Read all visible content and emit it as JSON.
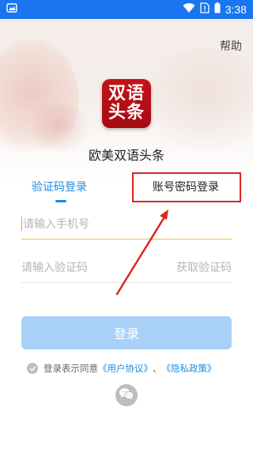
{
  "status_bar": {
    "time": "3:38",
    "icons": [
      "notification-icon",
      "wifi-icon",
      "no-sim-icon",
      "battery-icon"
    ],
    "background_color": "#1976f0"
  },
  "header": {
    "help_label": "帮助"
  },
  "app": {
    "icon_line1": "双语",
    "icon_line2": "头条",
    "name": "欧美双语头条",
    "icon_color": "#b3101a"
  },
  "tabs": [
    {
      "label": "验证码登录",
      "active": true
    },
    {
      "label": "账号密码登录",
      "active": false
    }
  ],
  "form": {
    "phone_placeholder": "请输入手机号",
    "code_placeholder": "请输入验证码",
    "get_code_label": "获取验证码",
    "login_label": "登录"
  },
  "agreement": {
    "prefix": "登录表示同意",
    "user_agreement": "《用户协议》",
    "separator": "、",
    "privacy_policy": "《隐私政策》"
  },
  "colors": {
    "accent": "#1b8be0",
    "login_button": "#a9d0f7",
    "annotation": "#e02121"
  },
  "social_login": [
    "wechat-icon"
  ]
}
